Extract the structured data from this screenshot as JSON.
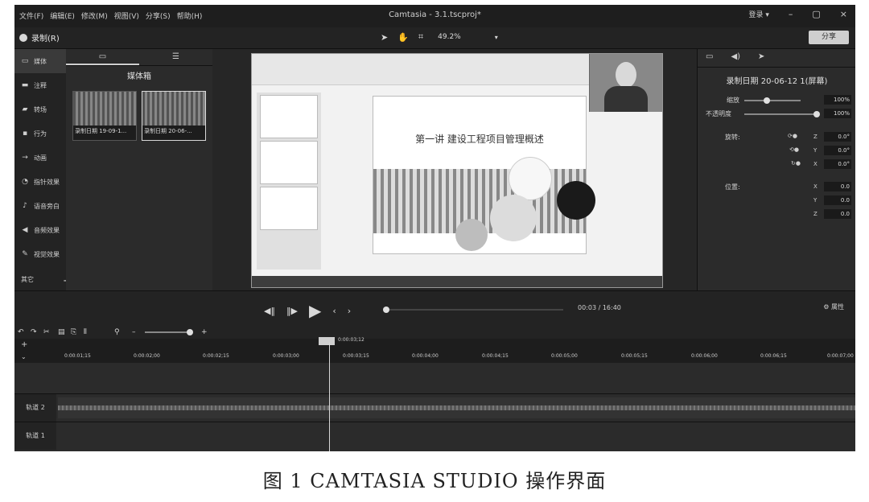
{
  "menu": [
    "文件(F)",
    "编辑(E)",
    "修改(M)",
    "视图(V)",
    "分享(S)",
    "帮助(H)"
  ],
  "window_title": "Camtasia - 3.1.tscproj*",
  "login_label": "登录 ▾",
  "window_controls": [
    "–",
    "▢",
    "×"
  ],
  "record_label": "录制(R)",
  "zoom_level": "49.2%",
  "share_label": "分享",
  "sidebar": [
    {
      "label": "媒体",
      "icon": "media-icon"
    },
    {
      "label": "注释",
      "icon": "annotation-icon"
    },
    {
      "label": "转场",
      "icon": "transition-icon"
    },
    {
      "label": "行为",
      "icon": "behavior-icon"
    },
    {
      "label": "动画",
      "icon": "animation-icon"
    },
    {
      "label": "指针效果",
      "icon": "cursor-effect-icon"
    },
    {
      "label": "语音旁白",
      "icon": "microphone-icon"
    },
    {
      "label": "音频效果",
      "icon": "audio-effect-icon"
    },
    {
      "label": "视觉效果",
      "icon": "visual-effect-icon"
    }
  ],
  "sidebar_more": "其它",
  "bin": {
    "heading": "媒体箱",
    "clips": [
      "录制日期 19-09-1...",
      "录制日期 20-06-..."
    ]
  },
  "slide": {
    "title": "第一讲 建设工程项目管理概述"
  },
  "properties": {
    "clip_name": "录制日期 20-06-12 1(屏幕)",
    "scale_label": "缩放",
    "scale_value": "100%",
    "opacity_label": "不透明度",
    "opacity_value": "100%",
    "rotation_label": "旋转:",
    "rotation": [
      {
        "axis": "Z",
        "value": "0.0°"
      },
      {
        "axis": "Y",
        "value": "0.0°"
      },
      {
        "axis": "X",
        "value": "0.0°"
      }
    ],
    "position_label": "位置:",
    "position": [
      {
        "axis": "X",
        "value": "0.0"
      },
      {
        "axis": "Y",
        "value": "0.0"
      },
      {
        "axis": "Z",
        "value": "0.0"
      }
    ]
  },
  "playback": {
    "time": "00:03 / 16:40",
    "properties_btn": "属性"
  },
  "timeline": {
    "playhead_time": "0:00:03;12",
    "ticks": [
      "0:00:01;15",
      "0:00:02;00",
      "0:00:02;15",
      "0:00:03;00",
      "0:00:03;15",
      "0:00:04;00",
      "0:00:04;15",
      "0:00:05;00",
      "0:00:05;15",
      "0:00:06;00",
      "0:00:06;15",
      "0:00:07;00"
    ],
    "tracks": [
      "轨道 2",
      "轨道 1"
    ]
  },
  "caption": "图 1   CAMTASIA  STUDIO 操作界面"
}
